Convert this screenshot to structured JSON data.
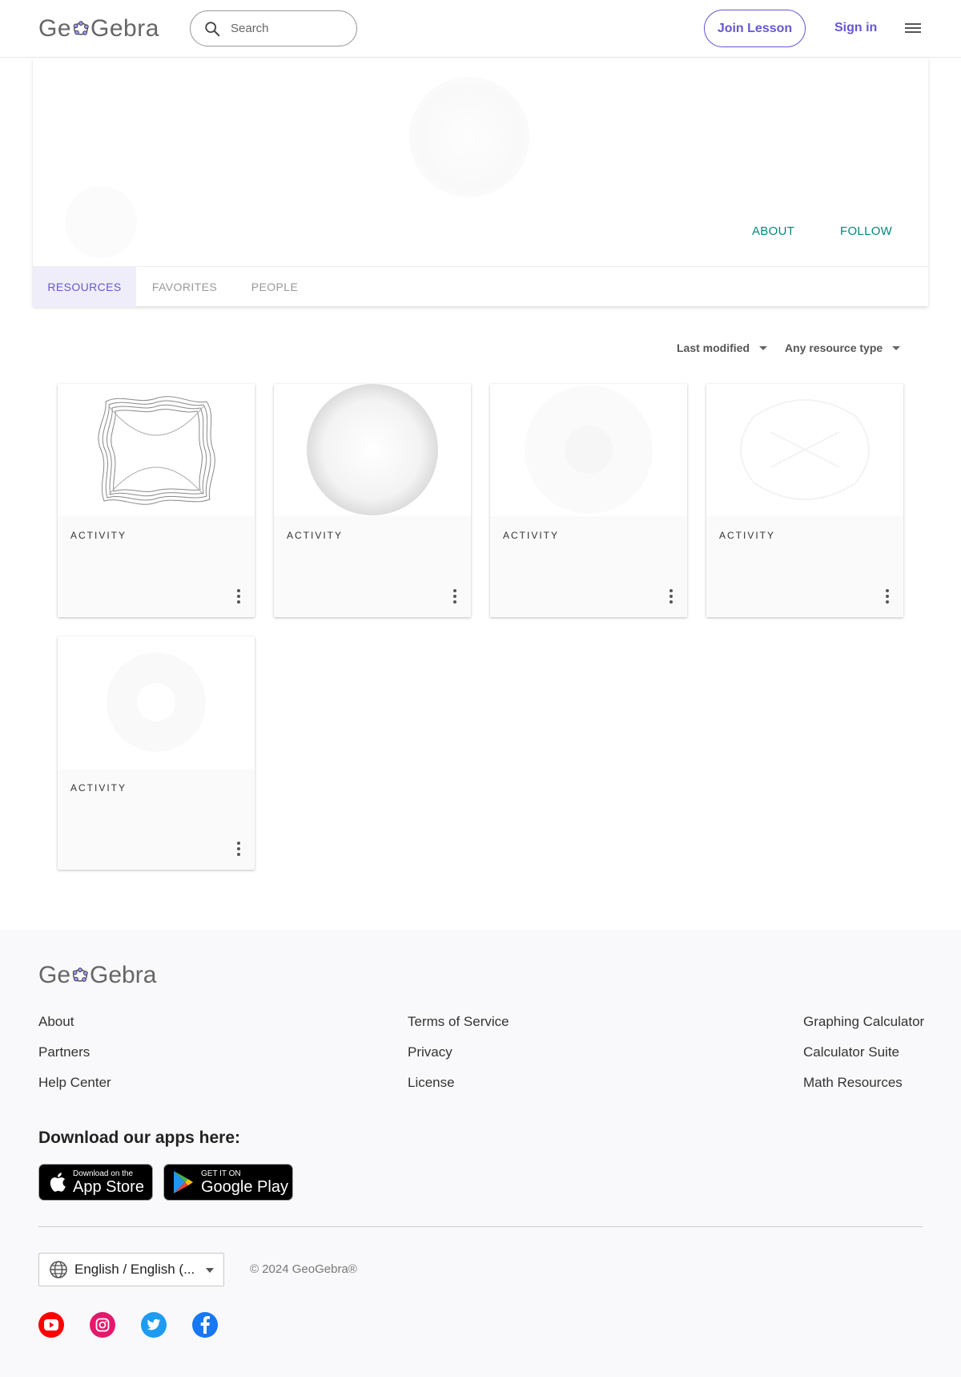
{
  "header": {
    "logo_text_left": "Ge",
    "logo_text_right": "Gebra",
    "search_placeholder": "Search",
    "join_label": "Join Lesson",
    "signin_label": "Sign in"
  },
  "profile": {
    "about_label": "ABOUT",
    "follow_label": "FOLLOW",
    "tabs": [
      {
        "label": "RESOURCES",
        "active": true
      },
      {
        "label": "FAVORITES",
        "active": false
      },
      {
        "label": "PEOPLE",
        "active": false
      }
    ]
  },
  "filters": {
    "sort_label": "Last modified",
    "type_label": "Any resource type"
  },
  "resources": [
    {
      "type": "ACTIVITY",
      "thumb": "wavy-square"
    },
    {
      "type": "ACTIVITY",
      "thumb": "gray-sphere"
    },
    {
      "type": "ACTIVITY",
      "thumb": "faint-circle"
    },
    {
      "type": "ACTIVITY",
      "thumb": "faint-pattern"
    },
    {
      "type": "ACTIVITY",
      "thumb": "faint-circle-small"
    }
  ],
  "footer": {
    "col1": [
      "About",
      "Partners",
      "Help Center"
    ],
    "col2": [
      "Terms of Service",
      "Privacy",
      "License"
    ],
    "col3": [
      "Graphing Calculator",
      "Calculator Suite",
      "Math Resources"
    ],
    "download_title": "Download our apps here:",
    "app_store_small": "Download on the",
    "app_store_big": "App Store",
    "google_play_small": "GET IT ON",
    "google_play_big": "Google Play",
    "language": "English / English (...",
    "copyright": "© 2024 GeoGebra®",
    "social": [
      "youtube-icon",
      "instagram-icon",
      "twitter-icon",
      "facebook-icon"
    ]
  },
  "colors": {
    "brand_purple": "#6557d2",
    "accent_teal": "#00897b",
    "youtube": "#ff0000",
    "instagram": "#e4196c",
    "twitter": "#1d9bf0",
    "facebook": "#1877f2"
  }
}
